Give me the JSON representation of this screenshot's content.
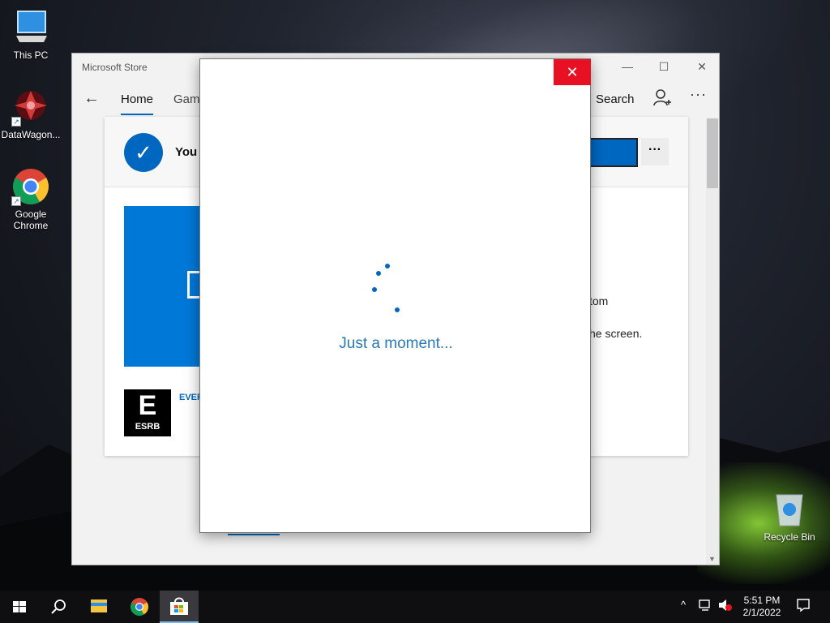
{
  "desktop": {
    "icons": [
      {
        "label": "This PC"
      },
      {
        "label": "DataWagon..."
      },
      {
        "label": "Google Chrome"
      },
      {
        "label": "Recycle Bin"
      }
    ]
  },
  "store_window": {
    "title": "Microsoft Store",
    "controls": {
      "minimize": "—",
      "maximize": "☐",
      "close": "✕"
    },
    "nav": {
      "back_icon": "←",
      "home_label": "Home",
      "games_label": "Gami",
      "search_label": "Search",
      "more_label": "···"
    },
    "banner": {
      "owned_text": "You o",
      "more_options": "···"
    },
    "details": {
      "esrb_letter": "E",
      "esrb_label": "ESRB",
      "rating_text": "EVER",
      "desc_line1": "tom",
      "desc_line2": "he screen."
    }
  },
  "dialog": {
    "close_icon": "✕",
    "loading_text": "Just a moment..."
  },
  "taskbar": {
    "time": "5:51 PM",
    "date": "2/1/2022",
    "accent_color": "#76b9ed"
  }
}
